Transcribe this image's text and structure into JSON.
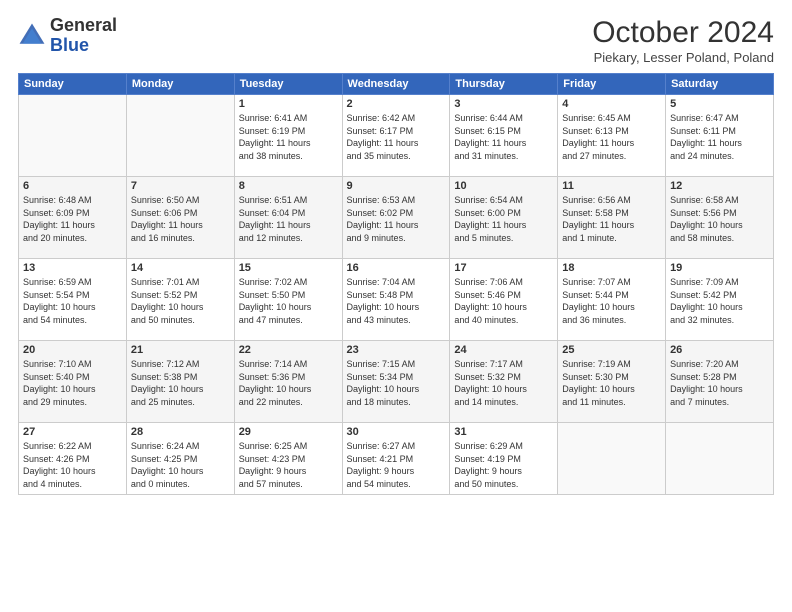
{
  "header": {
    "logo_general": "General",
    "logo_blue": "Blue",
    "month": "October 2024",
    "location": "Piekary, Lesser Poland, Poland"
  },
  "days_of_week": [
    "Sunday",
    "Monday",
    "Tuesday",
    "Wednesday",
    "Thursday",
    "Friday",
    "Saturday"
  ],
  "weeks": [
    [
      {
        "day": "",
        "info": ""
      },
      {
        "day": "",
        "info": ""
      },
      {
        "day": "1",
        "info": "Sunrise: 6:41 AM\nSunset: 6:19 PM\nDaylight: 11 hours\nand 38 minutes."
      },
      {
        "day": "2",
        "info": "Sunrise: 6:42 AM\nSunset: 6:17 PM\nDaylight: 11 hours\nand 35 minutes."
      },
      {
        "day": "3",
        "info": "Sunrise: 6:44 AM\nSunset: 6:15 PM\nDaylight: 11 hours\nand 31 minutes."
      },
      {
        "day": "4",
        "info": "Sunrise: 6:45 AM\nSunset: 6:13 PM\nDaylight: 11 hours\nand 27 minutes."
      },
      {
        "day": "5",
        "info": "Sunrise: 6:47 AM\nSunset: 6:11 PM\nDaylight: 11 hours\nand 24 minutes."
      }
    ],
    [
      {
        "day": "6",
        "info": "Sunrise: 6:48 AM\nSunset: 6:09 PM\nDaylight: 11 hours\nand 20 minutes."
      },
      {
        "day": "7",
        "info": "Sunrise: 6:50 AM\nSunset: 6:06 PM\nDaylight: 11 hours\nand 16 minutes."
      },
      {
        "day": "8",
        "info": "Sunrise: 6:51 AM\nSunset: 6:04 PM\nDaylight: 11 hours\nand 12 minutes."
      },
      {
        "day": "9",
        "info": "Sunrise: 6:53 AM\nSunset: 6:02 PM\nDaylight: 11 hours\nand 9 minutes."
      },
      {
        "day": "10",
        "info": "Sunrise: 6:54 AM\nSunset: 6:00 PM\nDaylight: 11 hours\nand 5 minutes."
      },
      {
        "day": "11",
        "info": "Sunrise: 6:56 AM\nSunset: 5:58 PM\nDaylight: 11 hours\nand 1 minute."
      },
      {
        "day": "12",
        "info": "Sunrise: 6:58 AM\nSunset: 5:56 PM\nDaylight: 10 hours\nand 58 minutes."
      }
    ],
    [
      {
        "day": "13",
        "info": "Sunrise: 6:59 AM\nSunset: 5:54 PM\nDaylight: 10 hours\nand 54 minutes."
      },
      {
        "day": "14",
        "info": "Sunrise: 7:01 AM\nSunset: 5:52 PM\nDaylight: 10 hours\nand 50 minutes."
      },
      {
        "day": "15",
        "info": "Sunrise: 7:02 AM\nSunset: 5:50 PM\nDaylight: 10 hours\nand 47 minutes."
      },
      {
        "day": "16",
        "info": "Sunrise: 7:04 AM\nSunset: 5:48 PM\nDaylight: 10 hours\nand 43 minutes."
      },
      {
        "day": "17",
        "info": "Sunrise: 7:06 AM\nSunset: 5:46 PM\nDaylight: 10 hours\nand 40 minutes."
      },
      {
        "day": "18",
        "info": "Sunrise: 7:07 AM\nSunset: 5:44 PM\nDaylight: 10 hours\nand 36 minutes."
      },
      {
        "day": "19",
        "info": "Sunrise: 7:09 AM\nSunset: 5:42 PM\nDaylight: 10 hours\nand 32 minutes."
      }
    ],
    [
      {
        "day": "20",
        "info": "Sunrise: 7:10 AM\nSunset: 5:40 PM\nDaylight: 10 hours\nand 29 minutes."
      },
      {
        "day": "21",
        "info": "Sunrise: 7:12 AM\nSunset: 5:38 PM\nDaylight: 10 hours\nand 25 minutes."
      },
      {
        "day": "22",
        "info": "Sunrise: 7:14 AM\nSunset: 5:36 PM\nDaylight: 10 hours\nand 22 minutes."
      },
      {
        "day": "23",
        "info": "Sunrise: 7:15 AM\nSunset: 5:34 PM\nDaylight: 10 hours\nand 18 minutes."
      },
      {
        "day": "24",
        "info": "Sunrise: 7:17 AM\nSunset: 5:32 PM\nDaylight: 10 hours\nand 14 minutes."
      },
      {
        "day": "25",
        "info": "Sunrise: 7:19 AM\nSunset: 5:30 PM\nDaylight: 10 hours\nand 11 minutes."
      },
      {
        "day": "26",
        "info": "Sunrise: 7:20 AM\nSunset: 5:28 PM\nDaylight: 10 hours\nand 7 minutes."
      }
    ],
    [
      {
        "day": "27",
        "info": "Sunrise: 6:22 AM\nSunset: 4:26 PM\nDaylight: 10 hours\nand 4 minutes."
      },
      {
        "day": "28",
        "info": "Sunrise: 6:24 AM\nSunset: 4:25 PM\nDaylight: 10 hours\nand 0 minutes."
      },
      {
        "day": "29",
        "info": "Sunrise: 6:25 AM\nSunset: 4:23 PM\nDaylight: 9 hours\nand 57 minutes."
      },
      {
        "day": "30",
        "info": "Sunrise: 6:27 AM\nSunset: 4:21 PM\nDaylight: 9 hours\nand 54 minutes."
      },
      {
        "day": "31",
        "info": "Sunrise: 6:29 AM\nSunset: 4:19 PM\nDaylight: 9 hours\nand 50 minutes."
      },
      {
        "day": "",
        "info": ""
      },
      {
        "day": "",
        "info": ""
      }
    ]
  ]
}
